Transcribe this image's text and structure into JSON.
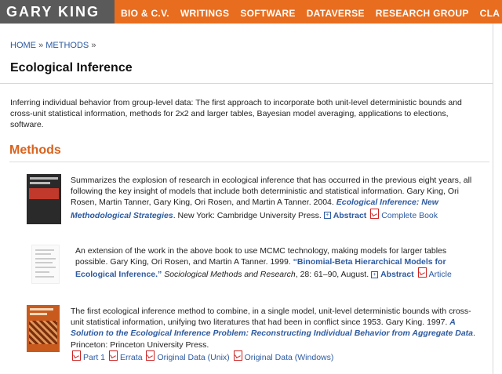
{
  "brand": "GARY KING",
  "nav": [
    "BIO & C.V.",
    "WRITINGS",
    "SOFTWARE",
    "DATAVERSE",
    "RESEARCH GROUP",
    "CLA"
  ],
  "breadcrumb": {
    "home": "HOME",
    "sep1": "»",
    "methods": "METHODS",
    "sep2": "»"
  },
  "page_title": "Ecological Inference",
  "description": "Inferring individual behavior from group-level data: The first approach to incorporate both unit-level deterministic bounds and cross-unit statistical information, methods for 2x2 and larger tables, Bayesian model averaging, applications to elections, software.",
  "section_title": "Methods",
  "entries": [
    {
      "summary": "Summarizes the explosion of research in ecological inference that has occurred in the previous eight years, all following the key insight of models that include both deterministic and statistical information.",
      "authors": "Gary King, Ori Rosen, Martin Tanner, Gary King, Ori Rosen, and Martin A Tanner. 2004.",
      "title": "Ecological Inference: New Methodological Strategies",
      "publisher": ". New York: Cambridge University Press.",
      "abstract": "Abstract",
      "link1": "Complete Book"
    },
    {
      "summary": "An extension of the work in the above book to use MCMC technology, making models for larger tables possible.",
      "authors": "Gary King, Ori Rosen, and Martin A Tanner. 1999.",
      "title": "“Binomial-Beta Hierarchical Models for Ecological Inference.”",
      "journal": "Sociological Methods and Research",
      "details": ", 28: 61–90, August.",
      "abstract": "Abstract",
      "link1": "Article"
    },
    {
      "summary": "The first ecological inference method to combine, in a single model, unit-level deterministic bounds with cross-unit statistical information, unifying two literatures that had been in conflict since 1953.",
      "authors": "Gary King. 1997.",
      "title": "A Solution to the Ecological Inference Problem: Reconstructing Individual Behavior from Aggregate Data",
      "publisher": ". Princeton: Princeton University Press.",
      "links": [
        "Part 1",
        "Errata",
        "Original Data (Unix)",
        "Original Data (Windows)"
      ]
    }
  ]
}
